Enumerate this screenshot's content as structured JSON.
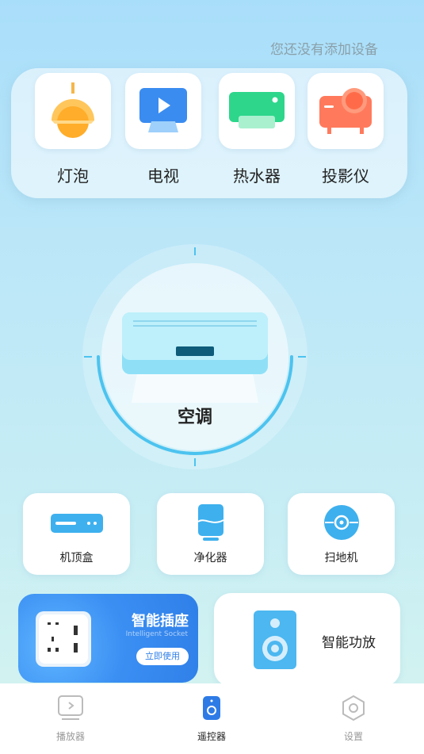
{
  "header": {
    "hint": "您还没有添加设备"
  },
  "top_devices": [
    {
      "label": "灯泡",
      "icon": "light-bulb-icon"
    },
    {
      "label": "电视",
      "icon": "tv-icon"
    },
    {
      "label": "热水器",
      "icon": "water-heater-icon"
    },
    {
      "label": "投影仪",
      "icon": "projector-icon"
    }
  ],
  "main_device": {
    "label": "空调",
    "icon": "air-conditioner-icon"
  },
  "small_devices": [
    {
      "label": "机顶盒",
      "icon": "set-top-box-icon"
    },
    {
      "label": "净化器",
      "icon": "air-purifier-icon"
    },
    {
      "label": "扫地机",
      "icon": "robot-vacuum-icon"
    }
  ],
  "socket_card": {
    "title": "智能插座",
    "subtitle": "Intelligent Socket",
    "button": "立即使用",
    "icon": "socket-icon"
  },
  "amp_card": {
    "label": "智能功放",
    "icon": "speaker-icon"
  },
  "tabs": [
    {
      "label": "播放器",
      "icon": "player-icon",
      "active": false
    },
    {
      "label": "遥控器",
      "icon": "remote-icon",
      "active": true
    },
    {
      "label": "设置",
      "icon": "settings-icon",
      "active": false
    }
  ],
  "colors": {
    "accent": "#2f7fe8",
    "ring": "#4cc3ef"
  }
}
